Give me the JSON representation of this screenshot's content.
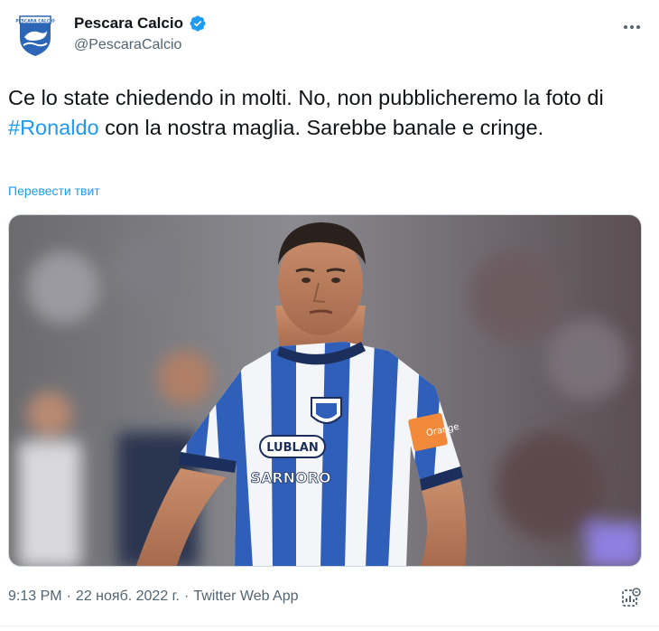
{
  "author": {
    "display_name": "Pescara Calcio",
    "handle": "@PescaraCalcio",
    "verified": true,
    "avatar_icon": "pescara-crest-icon",
    "avatar_text": "PESCARA CALCIO"
  },
  "tweet": {
    "text_before": "Ce lo state chiedendo in molti. No, non pubblicheremo la foto di ",
    "hashtag": "#Ronaldo",
    "text_after": " con la nostra maglia. Sarebbe banale e cringe.",
    "translate_label": "Перевести твит",
    "media": {
      "jersey_sponsor_top": "LUBLAN",
      "jersey_sponsor_main": "SARNORO",
      "jersey_sleeve_patch": "Orange"
    }
  },
  "meta": {
    "time": "9:13 PM",
    "separator": "·",
    "date": "22 нояб. 2022 г.",
    "source": "Twitter Web App"
  },
  "colors": {
    "accent": "#1d9bf0",
    "text": "#0f1419",
    "secondary": "#536471",
    "jersey_blue": "#2f5fb8"
  },
  "icons": {
    "more": "more-options-icon",
    "verified": "verified-badge-icon",
    "analytics": "analytics-icon"
  }
}
